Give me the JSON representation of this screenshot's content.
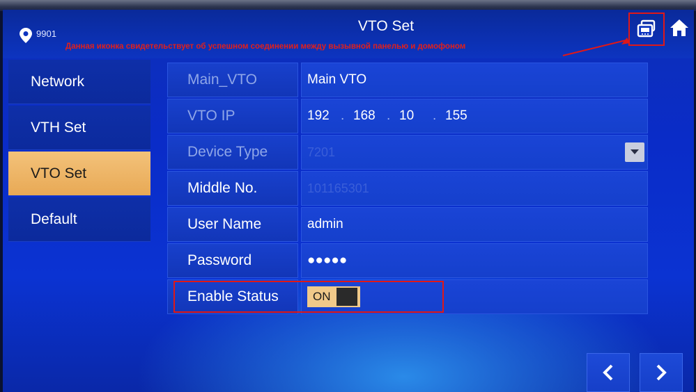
{
  "header": {
    "room_number": "9901",
    "title": "VTO Set",
    "annotation": "Данная иконка свидетельствует об успешном соединении между вызывной панелью и домофоном"
  },
  "icons": {
    "location": "map-pin-icon",
    "connection": "connection-status-icon",
    "home": "home-icon",
    "prev": "chevron-left-icon",
    "next": "chevron-right-icon"
  },
  "sidebar": {
    "items": [
      {
        "label": "Network",
        "active": false
      },
      {
        "label": "VTH Set",
        "active": false
      },
      {
        "label": "VTO Set",
        "active": true
      },
      {
        "label": "Default",
        "active": false
      }
    ]
  },
  "form": {
    "main_vto": {
      "label": "Main_VTO",
      "value": "Main VTO"
    },
    "vto_ip": {
      "label": "VTO IP",
      "octets": [
        "192",
        "168",
        "10",
        "155"
      ]
    },
    "device_type": {
      "label": "Device Type",
      "value": "7201"
    },
    "middle_no": {
      "label": "Middle No.",
      "value": "101165301"
    },
    "user_name": {
      "label": "User Name",
      "value": "admin"
    },
    "password": {
      "label": "Password",
      "value": "●●●●●"
    },
    "enable_status": {
      "label": "Enable Status",
      "value": "ON"
    }
  },
  "colors": {
    "accent_active": "#e8a955",
    "annotation_red": "#e01818",
    "background_blue": "#0a2cc8"
  }
}
